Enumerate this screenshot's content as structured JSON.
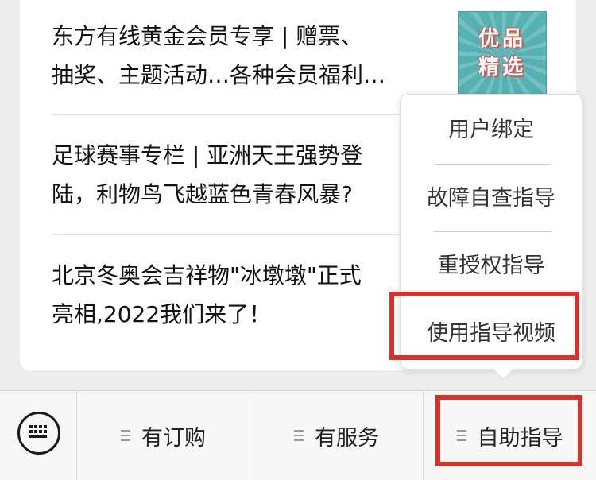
{
  "articles": [
    {
      "title": "东方有线黄金会员专享 | 赠票、\n抽奖、主题活动…各种会员福利…"
    },
    {
      "title": "足球赛事专栏 | 亚洲天王强势登\n陆，利物鸟飞越蓝色青春风暴?"
    },
    {
      "title": "北京冬奥会吉祥物\"冰墩墩\"正式\n亮相,2022我们来了！"
    }
  ],
  "thumbnail": {
    "text": "优品\n精选",
    "background": "#56b2b2"
  },
  "popup_menu": {
    "items": [
      "用户绑定",
      "故障自查指导",
      "重授权指导",
      "使用指导视频"
    ],
    "highlighted_index": 3
  },
  "bottom_menu": {
    "keyboard_icon": "keyboard-icon",
    "items": [
      {
        "label": "有订购",
        "icon": "menu-lines-icon"
      },
      {
        "label": "有服务",
        "icon": "menu-lines-icon"
      },
      {
        "label": "自助指导",
        "icon": "menu-lines-icon"
      }
    ],
    "highlighted_index": 2
  },
  "colors": {
    "highlight": "#d8312c",
    "background": "#ededed"
  }
}
